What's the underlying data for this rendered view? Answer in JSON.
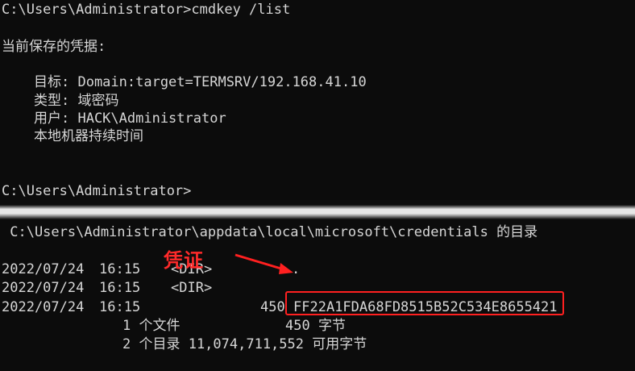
{
  "terminal_top": {
    "prompt_command": "C:\\Users\\Administrator>cmdkey /list",
    "saved_credentials_header": "当前保存的凭据:",
    "target_line": "目标: Domain:target=TERMSRV/192.168.41.10",
    "type_line": "类型: 域密码",
    "user_line": "用户: HACK\\Administrator",
    "persistence_line": "本地机器持续时间",
    "prompt_end": "C:\\Users\\Administrator>"
  },
  "terminal_bottom": {
    "directory_header": " C:\\Users\\Administrator\\appdata\\local\\microsoft\\credentials 的目录",
    "entries": [
      {
        "date": "2022/07/24",
        "time": "16:15",
        "type": "<DIR>",
        "size": "",
        "name": "."
      },
      {
        "date": "2022/07/24",
        "time": "16:15",
        "type": "<DIR>",
        "size": "",
        "name": ""
      },
      {
        "date": "2022/07/24",
        "time": "16:15",
        "type": "",
        "size": "450",
        "name": "FF22A1FDA68FD8515B52C534E8655421"
      }
    ],
    "files_summary_count": "1 个文件",
    "files_summary_bytes": "450 字节",
    "dirs_summary": "2 个目录 11,074,711,552 可用字节"
  },
  "annotation": {
    "label": "凭证",
    "color": "#ff2020"
  }
}
